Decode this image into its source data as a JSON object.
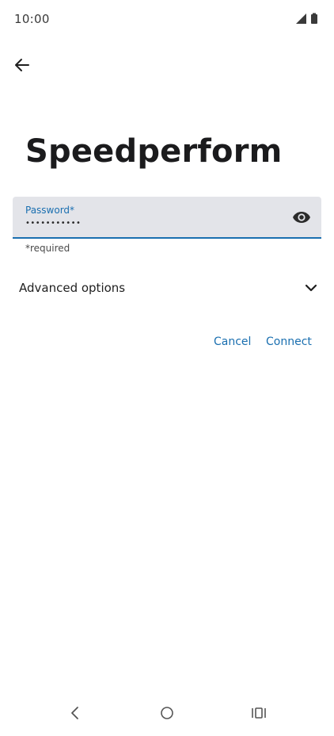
{
  "status_bar": {
    "time": "10:00",
    "icons": [
      "signal-icon",
      "battery-icon"
    ]
  },
  "header": {
    "back_icon": "arrow-left-icon"
  },
  "title": "Speedperform",
  "password_field": {
    "label": "Password*",
    "value": "•••••••••••",
    "toggle_icon": "eye-icon",
    "accent_color": "#1a6fb0"
  },
  "helper_text": "*required",
  "advanced": {
    "label": "Advanced options",
    "icon": "chevron-down-icon"
  },
  "actions": {
    "cancel_label": "Cancel",
    "connect_label": "Connect"
  },
  "nav_bar": {
    "icons": [
      "nav-back-icon",
      "nav-home-icon",
      "nav-recents-icon"
    ]
  }
}
